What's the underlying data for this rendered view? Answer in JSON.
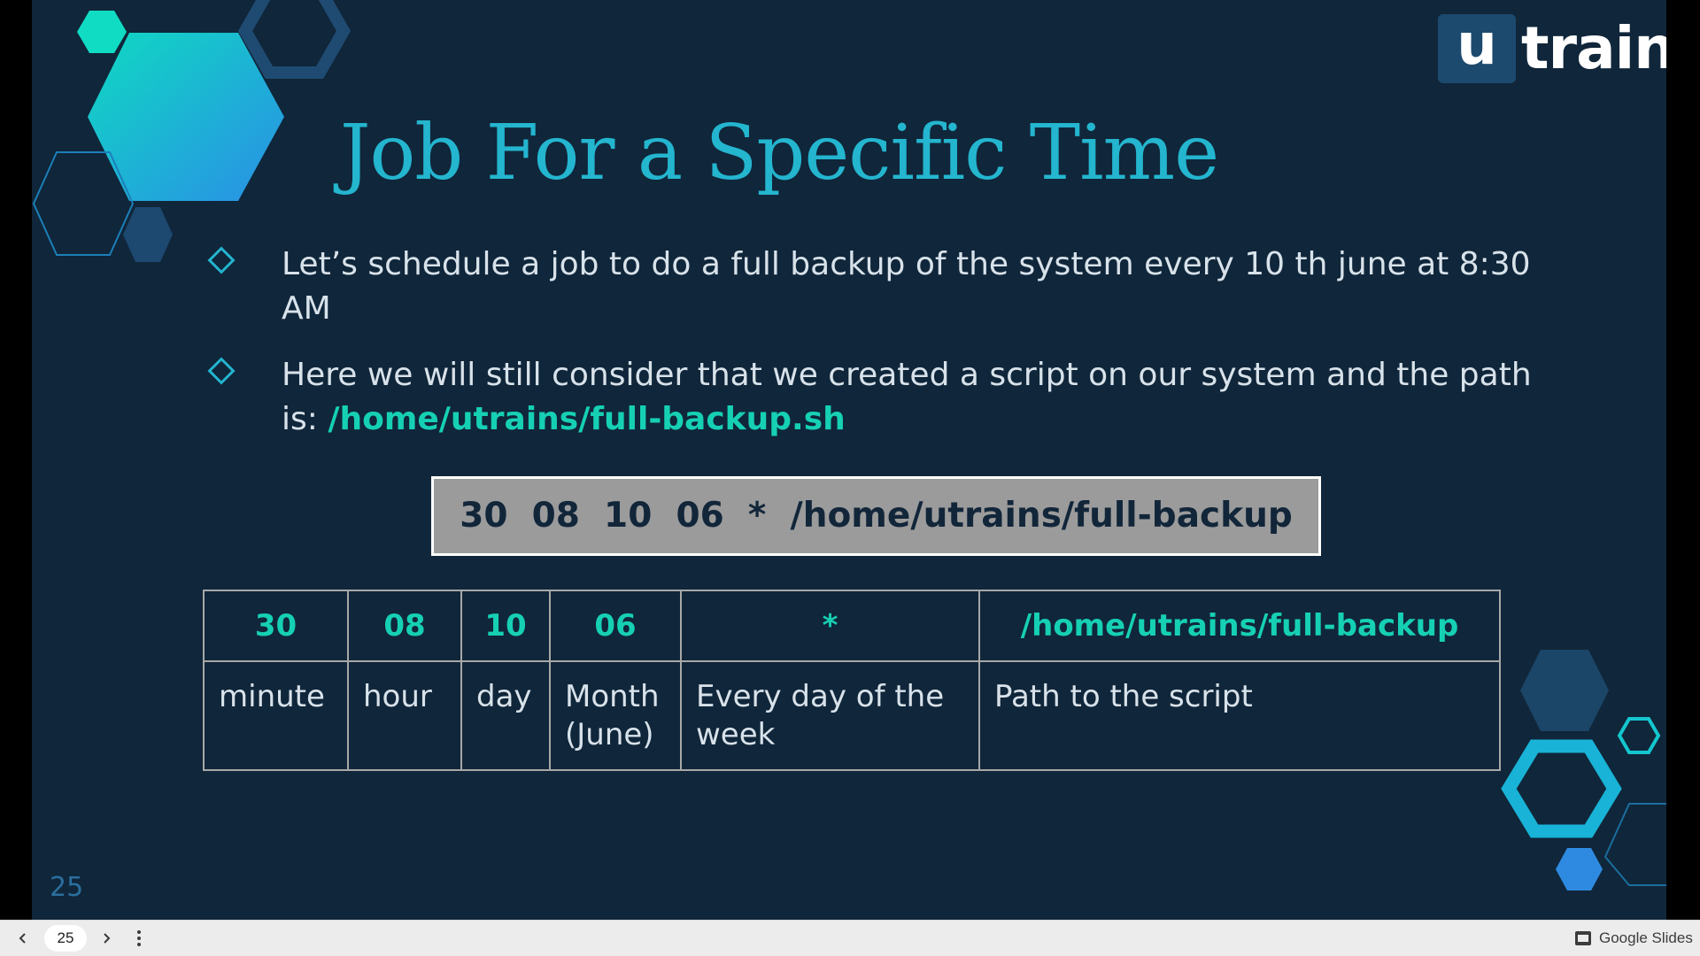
{
  "logo": {
    "mark": "u",
    "text": "train"
  },
  "slide": {
    "title": "Job For a Specific Time",
    "bullets": [
      {
        "text": "Let’s schedule a job to do a full backup of the system every 10 th june at 8:30 AM",
        "path": ""
      },
      {
        "text": "Here we will still consider that we created a script on our system and the path is: ",
        "path": "/home/utrains/full-backup.sh"
      }
    ],
    "command": "30  08  10  06  *  /home/utrains/full-backup",
    "table": {
      "head": [
        "30",
        "08",
        "10",
        "06",
        "*",
        "/home/utrains/full-backup"
      ],
      "desc": [
        "minute",
        "hour",
        "day",
        "Month (June)",
        "Every day of the week",
        "Path to the script"
      ]
    },
    "page_number": "25"
  },
  "toolbar": {
    "current_page": "25",
    "app_name": "Google Slides"
  },
  "colors": {
    "background": "#10263a",
    "accent": "#24b5cf",
    "path_highlight": "#16d0b4",
    "body_text": "#d8e2ea",
    "command_box": "#9b9b9b"
  }
}
